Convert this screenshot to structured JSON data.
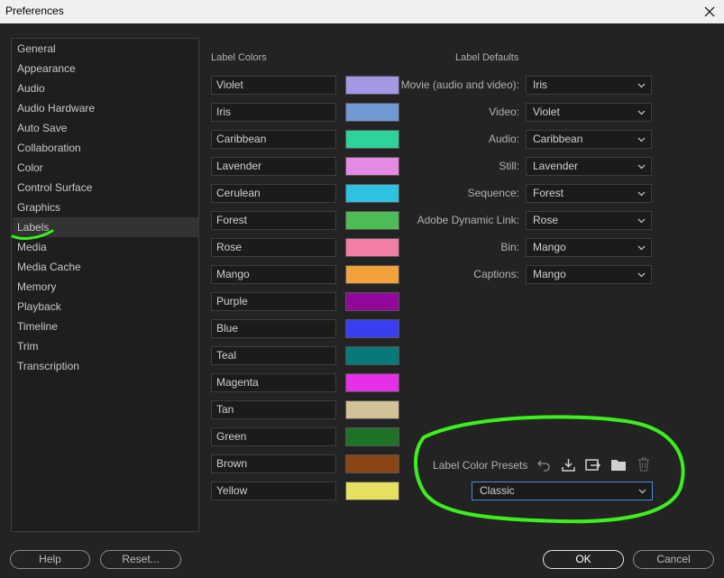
{
  "window": {
    "title": "Preferences"
  },
  "sidebar": {
    "items": [
      {
        "label": "General"
      },
      {
        "label": "Appearance"
      },
      {
        "label": "Audio"
      },
      {
        "label": "Audio Hardware"
      },
      {
        "label": "Auto Save"
      },
      {
        "label": "Collaboration"
      },
      {
        "label": "Color"
      },
      {
        "label": "Control Surface"
      },
      {
        "label": "Graphics"
      },
      {
        "label": "Labels"
      },
      {
        "label": "Media"
      },
      {
        "label": "Media Cache"
      },
      {
        "label": "Memory"
      },
      {
        "label": "Playback"
      },
      {
        "label": "Timeline"
      },
      {
        "label": "Trim"
      },
      {
        "label": "Transcription"
      }
    ],
    "selected": "Labels"
  },
  "label_colors": {
    "heading": "Label Colors",
    "items": [
      {
        "name": "Violet",
        "color": "#a596e6"
      },
      {
        "name": "Iris",
        "color": "#6f98d4"
      },
      {
        "name": "Caribbean",
        "color": "#2ed39c"
      },
      {
        "name": "Lavender",
        "color": "#e489e4"
      },
      {
        "name": "Cerulean",
        "color": "#2ec1e0"
      },
      {
        "name": "Forest",
        "color": "#4ebc56"
      },
      {
        "name": "Rose",
        "color": "#f27ea5"
      },
      {
        "name": "Mango",
        "color": "#f2a23c"
      },
      {
        "name": "Purple",
        "color": "#92089a"
      },
      {
        "name": "Blue",
        "color": "#3a3ef2"
      },
      {
        "name": "Teal",
        "color": "#067a7a"
      },
      {
        "name": "Magenta",
        "color": "#e82fe8"
      },
      {
        "name": "Tan",
        "color": "#d1c196"
      },
      {
        "name": "Green",
        "color": "#1d7226"
      },
      {
        "name": "Brown",
        "color": "#8a4514"
      },
      {
        "name": "Yellow",
        "color": "#e6e060"
      }
    ]
  },
  "label_defaults": {
    "heading": "Label Defaults",
    "items": [
      {
        "label": "Movie (audio and video):",
        "value": "Iris"
      },
      {
        "label": "Video:",
        "value": "Violet"
      },
      {
        "label": "Audio:",
        "value": "Caribbean"
      },
      {
        "label": "Still:",
        "value": "Lavender"
      },
      {
        "label": "Sequence:",
        "value": "Forest"
      },
      {
        "label": "Adobe Dynamic Link:",
        "value": "Rose"
      },
      {
        "label": "Bin:",
        "value": "Mango"
      },
      {
        "label": "Captions:",
        "value": "Mango"
      }
    ]
  },
  "presets": {
    "label": "Label Color Presets",
    "value": "Classic",
    "icons": [
      "undo-icon",
      "import-icon",
      "export-icon",
      "folder-icon",
      "trash-icon"
    ]
  },
  "buttons": {
    "help": "Help",
    "reset": "Reset...",
    "ok": "OK",
    "cancel": "Cancel"
  },
  "colors": {
    "annotation": "#3cf01e",
    "focus": "#4a8be0"
  }
}
